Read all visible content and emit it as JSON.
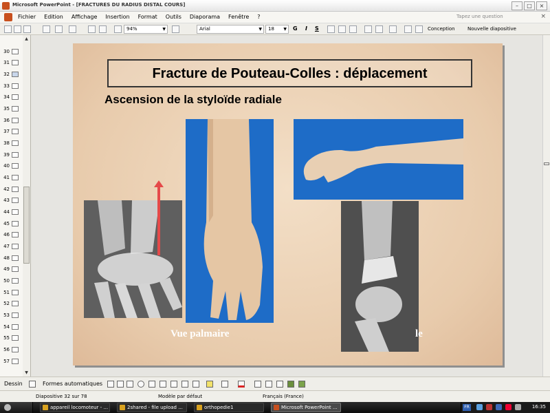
{
  "window": {
    "title": "Microsoft PowerPoint - [FRACTURES DU RADIUS DISTAL COURS]"
  },
  "menu": {
    "items": [
      "Fichier",
      "Edition",
      "Affichage",
      "Insertion",
      "Format",
      "Outils",
      "Diaporama",
      "Fenêtre",
      "?"
    ],
    "question_placeholder": "Tapez une question"
  },
  "toolbar": {
    "zoom": "94%",
    "font": "Arial",
    "size": "18",
    "bold": "G",
    "italic": "I",
    "shadow": "S",
    "conception": "Conception",
    "new_slide": "Nouvelle diapositive"
  },
  "outline": {
    "slide_numbers": [
      "30",
      "31",
      "32",
      "33",
      "34",
      "35",
      "36",
      "37",
      "38",
      "39",
      "40",
      "41",
      "42",
      "43",
      "44",
      "45",
      "46",
      "47",
      "48",
      "49",
      "50",
      "51",
      "52",
      "53",
      "54",
      "55",
      "56",
      "57"
    ],
    "active": "32"
  },
  "slide": {
    "title": "Fracture de Pouteau-Colles : déplacement",
    "subtitle": "Ascension de la styloïde radiale",
    "caption_left": "Vue palmaire",
    "caption_right": "le",
    "colors": {
      "background": "#e8cbac",
      "arrow": "#e54949",
      "photo_bg": "#1e6cc7"
    }
  },
  "drawbar": {
    "dessin": "Dessin",
    "formes": "Formes automatiques"
  },
  "status": {
    "slide": "Diapositive 32 sur 78",
    "template": "Modèle par défaut",
    "language": "Français (France)"
  },
  "taskbar": {
    "tasks": [
      "appareil locomoteur - ...",
      "2shared - file upload ...",
      "orthopedie1",
      "Microsoft PowerPoint ..."
    ],
    "lang": "FR",
    "clock": "16:35"
  }
}
